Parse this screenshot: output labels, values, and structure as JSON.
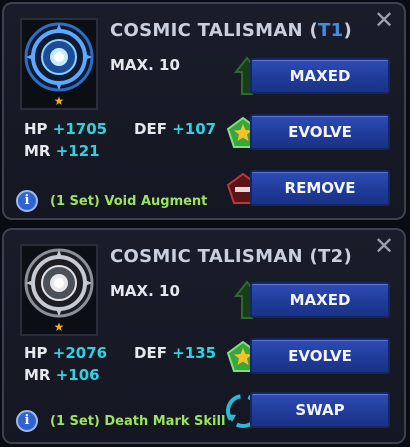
{
  "panels": [
    {
      "title": "COSMIC TALISMAN",
      "tier": "T1",
      "stars": "★",
      "max_label": "MAX. 10",
      "hp_label": "HP",
      "hp_value": "+1705",
      "mr_label": "MR",
      "mr_value": "+121",
      "def_label": "DEF",
      "def_value": "+107",
      "btn_maxed": "MAXED",
      "btn_evolve": "EVOLVE",
      "btn_action": "REMOVE",
      "set_text": "(1 Set) Void Augment",
      "close": "✕",
      "info": "i",
      "icon": "cosmic-talisman-blue-icon"
    },
    {
      "title": "COSMIC TALISMAN",
      "tier": "T2",
      "stars": "★",
      "max_label": "MAX. 10",
      "hp_label": "HP",
      "hp_value": "+2076",
      "mr_label": "MR",
      "mr_value": "+106",
      "def_label": "DEF",
      "def_value": "+135",
      "btn_maxed": "MAXED",
      "btn_evolve": "EVOLVE",
      "btn_action": "SWAP",
      "set_text": "(1 Set) Death Mark Skill",
      "close": "✕",
      "info": "i",
      "icon": "cosmic-talisman-silver-icon"
    }
  ],
  "colors": {
    "accent_blue": "#3f8fe8",
    "stat_cyan": "#35d0e0",
    "set_green": "#9ee25e",
    "button_blue": "#2a45ab"
  }
}
